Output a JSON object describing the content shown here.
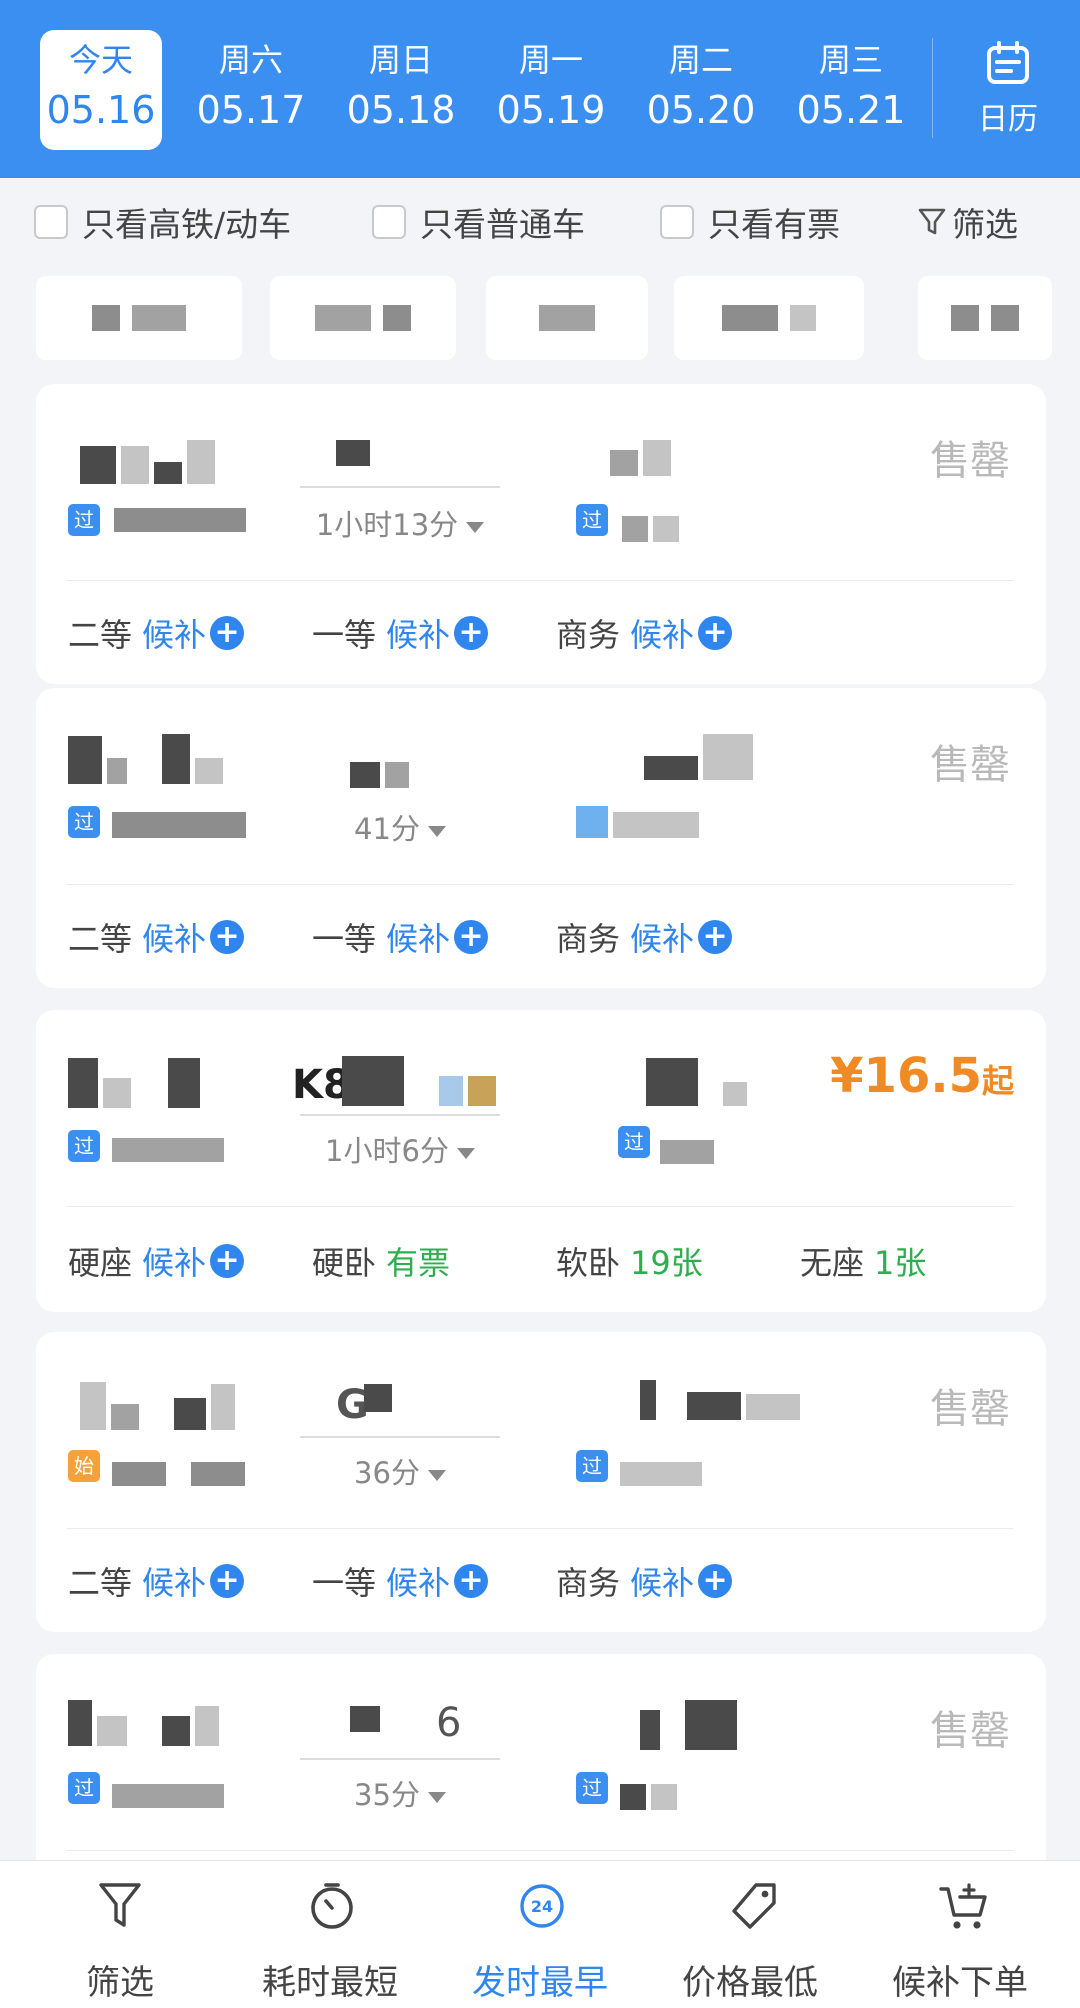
{
  "dates": [
    {
      "weekday": "今天",
      "date": "05.16",
      "active": true
    },
    {
      "weekday": "周六",
      "date": "05.17"
    },
    {
      "weekday": "周日",
      "date": "05.18"
    },
    {
      "weekday": "周一",
      "date": "05.19"
    },
    {
      "weekday": "周二",
      "date": "05.20"
    },
    {
      "weekday": "周三",
      "date": "05.21"
    }
  ],
  "calendar_label": "日历",
  "filters": {
    "high_speed": "只看高铁/动车",
    "normal": "只看普通车",
    "has_ticket": "只看有票",
    "filter": "筛选"
  },
  "trains": [
    {
      "number": "",
      "duration": "1小时13分",
      "from_tag": "过",
      "to_tag": "过",
      "status": "售罄",
      "seats": [
        {
          "name": "二等",
          "status": "候补"
        },
        {
          "name": "一等",
          "status": "候补"
        },
        {
          "name": "商务",
          "status": "候补"
        }
      ]
    },
    {
      "number": "",
      "duration": "41分",
      "from_tag": "过",
      "to_tag": "",
      "status": "售罄",
      "seats": [
        {
          "name": "二等",
          "status": "候补"
        },
        {
          "name": "一等",
          "status": "候补"
        },
        {
          "name": "商务",
          "status": "候补"
        }
      ]
    },
    {
      "number": "K8",
      "duration": "1小时6分",
      "from_tag": "过",
      "to_tag": "过",
      "price": "¥16.5",
      "price_suffix": "起",
      "seats": [
        {
          "name": "硬座",
          "status": "候补"
        },
        {
          "name": "硬卧",
          "status": "有票"
        },
        {
          "name": "软卧",
          "status": "19张"
        },
        {
          "name": "无座",
          "status": "1张"
        }
      ]
    },
    {
      "number": "G",
      "duration": "36分",
      "from_tag": "始",
      "to_tag": "过",
      "status": "售罄",
      "seats": [
        {
          "name": "二等",
          "status": "候补"
        },
        {
          "name": "一等",
          "status": "候补"
        },
        {
          "name": "商务",
          "status": "候补"
        }
      ]
    },
    {
      "number": "6",
      "duration": "35分",
      "from_tag": "过",
      "to_tag": "过",
      "status": "售罄"
    }
  ],
  "bottom_nav": [
    {
      "label": "筛选",
      "icon": "funnel-icon"
    },
    {
      "label": "耗时最短",
      "icon": "timer-icon"
    },
    {
      "label": "发时最早",
      "icon": "clock-24-icon",
      "active": true
    },
    {
      "label": "价格最低",
      "icon": "price-tag-icon"
    },
    {
      "label": "候补下单",
      "icon": "cart-plus-icon"
    }
  ],
  "colors": {
    "brand_blue": "#3b8ff0",
    "link_blue": "#2f86ee",
    "price_orange": "#f08a24",
    "available_green": "#2fae4f",
    "sold_out_gray": "#b9b9b9"
  }
}
